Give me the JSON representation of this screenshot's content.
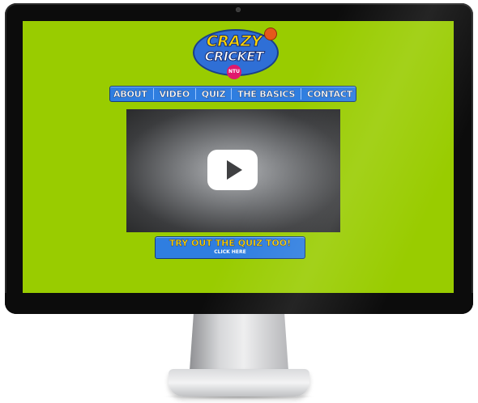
{
  "logo": {
    "line1": "CRAZY",
    "line2": "CRICKET",
    "badge": "NTU"
  },
  "nav": {
    "items": [
      {
        "label": "ABOUT"
      },
      {
        "label": "VIDEO"
      },
      {
        "label": "QUIZ"
      },
      {
        "label": "THE BASICS"
      },
      {
        "label": "CONTACT"
      }
    ]
  },
  "video": {
    "icon": "play-icon"
  },
  "cta": {
    "main_label": "TRY OUT THE QUIZ TOO!",
    "sub_label": "CLICK HERE"
  },
  "colors": {
    "page_bg": "#99cc00",
    "nav_bg": "#2f7ee0",
    "accent_yellow": "#ffd400"
  }
}
